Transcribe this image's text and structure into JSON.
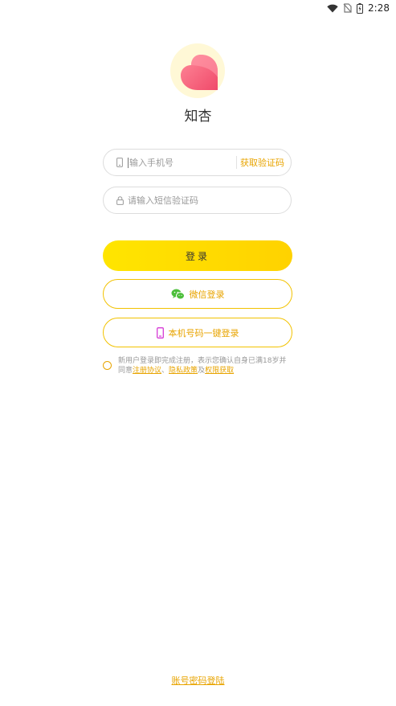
{
  "status_bar": {
    "time": "2:28",
    "icons": [
      "wifi-icon",
      "no-sim-icon",
      "battery-charging-icon"
    ]
  },
  "app": {
    "name": "知杏",
    "logo_icon": "heart-logo-icon"
  },
  "form": {
    "phone_placeholder": "输入手机号",
    "get_code_label": "获取验证码",
    "code_placeholder": "请输入短信验证码"
  },
  "buttons": {
    "login_label": "登录",
    "wechat_label": "微信登录",
    "onekey_label": "本机号码一键登录"
  },
  "agreement": {
    "text_before": "新用户登录即完成注册，表示您确认自身已满18岁并同意",
    "link_register": "注册协议",
    "sep1": "、",
    "link_privacy": "隐私政策",
    "sep2": "及",
    "link_permission": "权限获取"
  },
  "footer": {
    "password_login": "账号密码登陆"
  },
  "colors": {
    "accent": "#e8a400",
    "button_yellow": "#ffde00",
    "logo_pink": "#f2627a",
    "logo_bg": "#fff8d6",
    "wechat_green": "#4cbf3a",
    "phone_magenta": "#d63ad6"
  }
}
